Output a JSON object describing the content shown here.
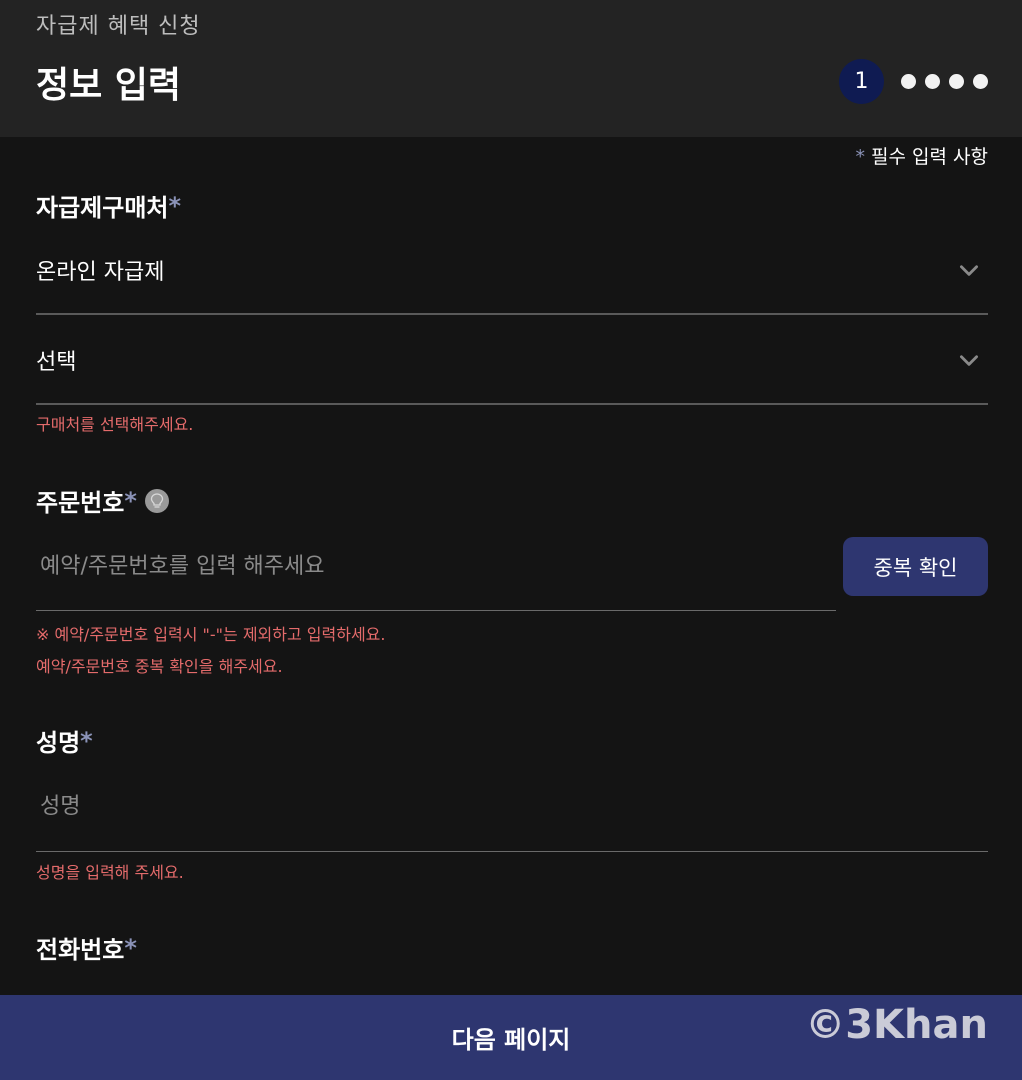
{
  "header": {
    "breadcrumb": "자급제 혜택 신청",
    "title": "정보 입력",
    "current_step": "1"
  },
  "required_note": {
    "star": "*",
    "text": "필수 입력 사항"
  },
  "fields": {
    "purchase_place": {
      "label": "자급제구매처",
      "star": "*",
      "select1_value": "온라인 자급제",
      "select2_value": "선택",
      "error": "구매처를 선택해주세요."
    },
    "order_number": {
      "label": "주문번호",
      "star": "*",
      "placeholder": "예약/주문번호를 입력 해주세요",
      "button": "중복 확인",
      "note": "※ 예약/주문번호 입력시 \"-\"는 제외하고 입력하세요.",
      "error": "예약/주문번호 중복 확인을 해주세요."
    },
    "name": {
      "label": "성명",
      "star": "*",
      "placeholder": "성명",
      "error": "성명을 입력해 주세요."
    },
    "phone": {
      "label": "전화번호",
      "star": "*"
    }
  },
  "footer": {
    "next_button": "다음 페이지",
    "watermark": "©3Khan"
  },
  "colors": {
    "background": "#141414",
    "header": "#232323",
    "accent": "#2e3670",
    "error": "#e46b6b"
  }
}
